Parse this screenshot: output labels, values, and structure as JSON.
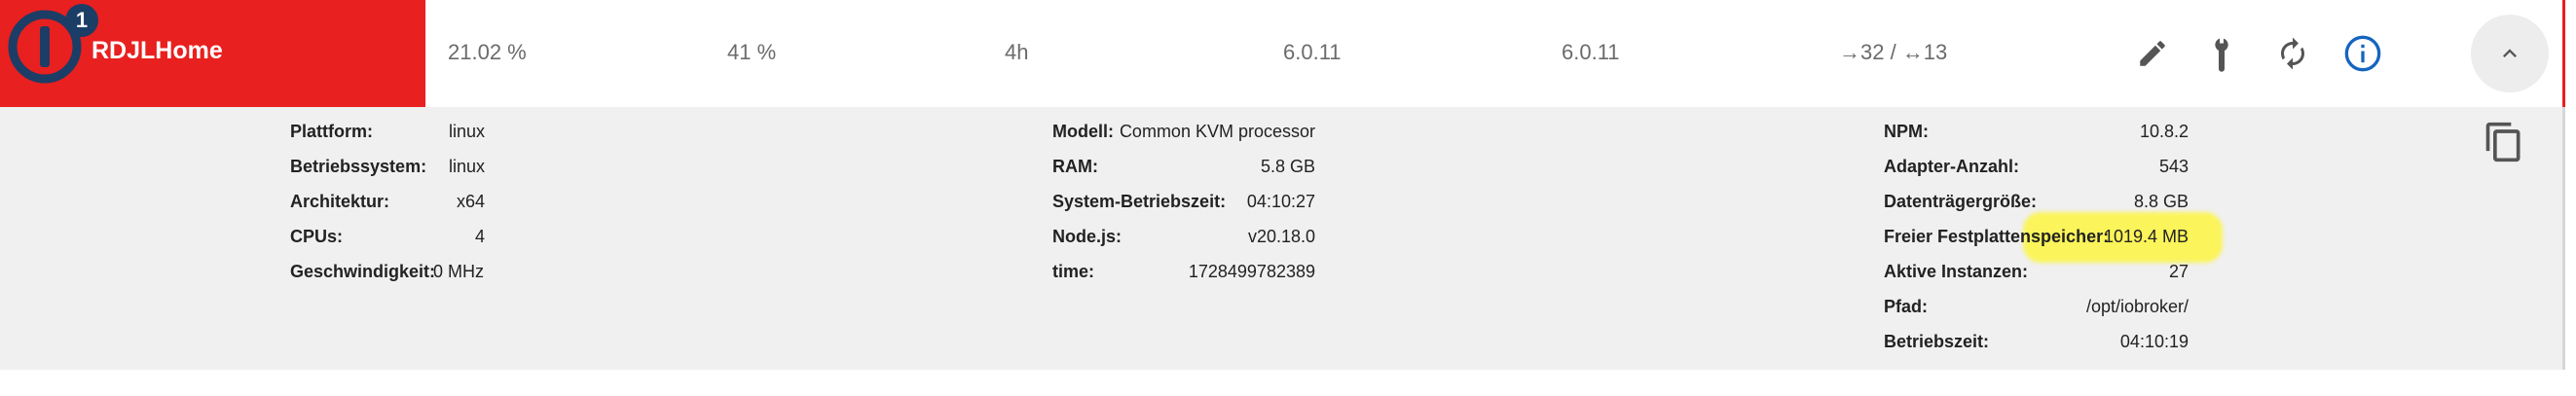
{
  "host": {
    "name": "RDJLHome",
    "badge_count": "1"
  },
  "metrics": {
    "cpu": "21.02 %",
    "memory": "41 %",
    "uptime": "4h",
    "version_installed": "6.0.11",
    "version_available": "6.0.11",
    "events": "→32 / ↔13"
  },
  "toolbar": {
    "icons": [
      "edit-icon",
      "wrench-icon",
      "refresh-icon",
      "info-icon",
      "chevron-up-icon",
      "copy-icon"
    ]
  },
  "details": {
    "col1": [
      {
        "label": "Plattform:",
        "value": "linux"
      },
      {
        "label": "Betriebssystem:",
        "value": "linux"
      },
      {
        "label": "Architektur:",
        "value": "x64"
      },
      {
        "label": "CPUs:",
        "value": "4"
      },
      {
        "label": "Geschwindigkeit:",
        "value": "0 MHz"
      }
    ],
    "col2": [
      {
        "label": "Modell:",
        "value": "Common KVM processor"
      },
      {
        "label": "RAM:",
        "value": "5.8 GB"
      },
      {
        "label": "System-Betriebszeit:",
        "value": "04:10:27"
      },
      {
        "label": "Node.js:",
        "value": "v20.18.0"
      },
      {
        "label": "time:",
        "value": "1728499782389"
      }
    ],
    "col3": [
      {
        "label": "NPM:",
        "value": "10.8.2"
      },
      {
        "label": "Adapter-Anzahl:",
        "value": "543"
      },
      {
        "label": "Datenträgergröße:",
        "value": "8.8 GB"
      },
      {
        "label": "Freier Festplattenspeicher:",
        "value": "1019.4 MB"
      },
      {
        "label": "Aktive Instanzen:",
        "value": "27"
      },
      {
        "label": "Pfad:",
        "value": "/opt/iobroker/"
      },
      {
        "label": "Betriebszeit:",
        "value": "04:10:19"
      }
    ]
  },
  "colors": {
    "brand_red": "#e8201f",
    "logo_blue": "#1c3d66",
    "highlight": "#fff528"
  }
}
